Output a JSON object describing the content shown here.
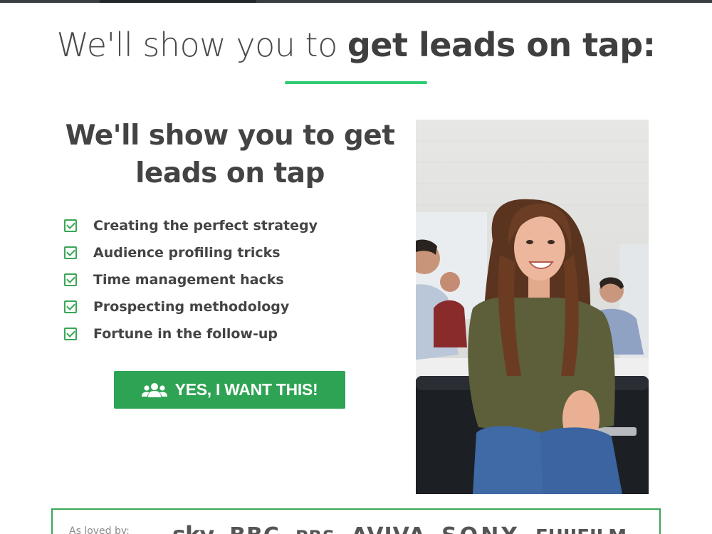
{
  "hero": {
    "title_light": "We'll show you to ",
    "title_bold": "get leads on tap:"
  },
  "offer": {
    "title_line1": "We'll show you to get",
    "title_line2": "leads on tap",
    "features": [
      "Creating the perfect strategy",
      "Audience profiling tricks",
      "Time management hacks",
      "Prospecting methodology",
      "Fortune in the follow-up"
    ],
    "cta_label": "YES, I WANT THIS!",
    "cta_icon": "users-icon"
  },
  "photo": {
    "alt": "Smiling woman with long wavy hair sitting in an office"
  },
  "social_proof": {
    "label": "As loved by:",
    "logos": [
      "sky",
      "BBC",
      "PBS",
      "AVIVA",
      "SONY",
      "FUJIFILM"
    ]
  },
  "colors": {
    "accent_green": "#2fa354",
    "underline_green": "#2ecc71",
    "text_dark": "#434343"
  }
}
